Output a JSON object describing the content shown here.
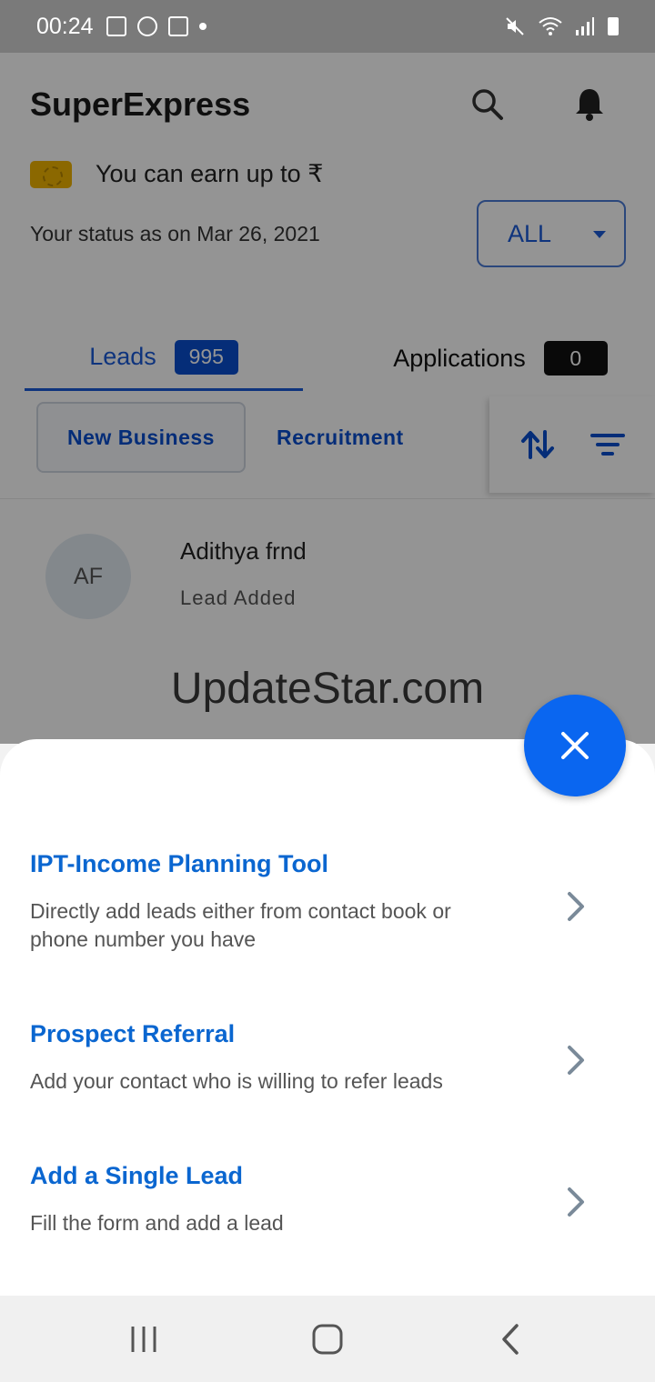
{
  "status_bar": {
    "time": "00:24"
  },
  "app": {
    "title": "SuperExpress",
    "earn_text": "You can earn up to ₹",
    "status_text": "Your status as on Mar 26, 2021",
    "filter_value": "ALL",
    "tabs": [
      {
        "label": "Leads",
        "count": "995"
      },
      {
        "label": "Applications",
        "count": "0"
      }
    ],
    "subtabs": [
      {
        "label": "New Business"
      },
      {
        "label": "Recruitment"
      }
    ],
    "lead": {
      "initials": "AF",
      "name": "Adithya frnd",
      "status": "Lead Added"
    },
    "watermark": "UpdateStar.com"
  },
  "sheet": {
    "options": [
      {
        "title": "IPT-Income Planning Tool",
        "desc": "Directly add leads either from contact book or phone number you have"
      },
      {
        "title": "Prospect Referral",
        "desc": "Add your contact who is willing to refer leads"
      },
      {
        "title": "Add a Single Lead",
        "desc": "Fill the form and add a lead"
      }
    ]
  },
  "colors": {
    "accent": "#0a66f0",
    "link_blue": "#0a66d0",
    "badge_blue": "#0a4fcf"
  }
}
